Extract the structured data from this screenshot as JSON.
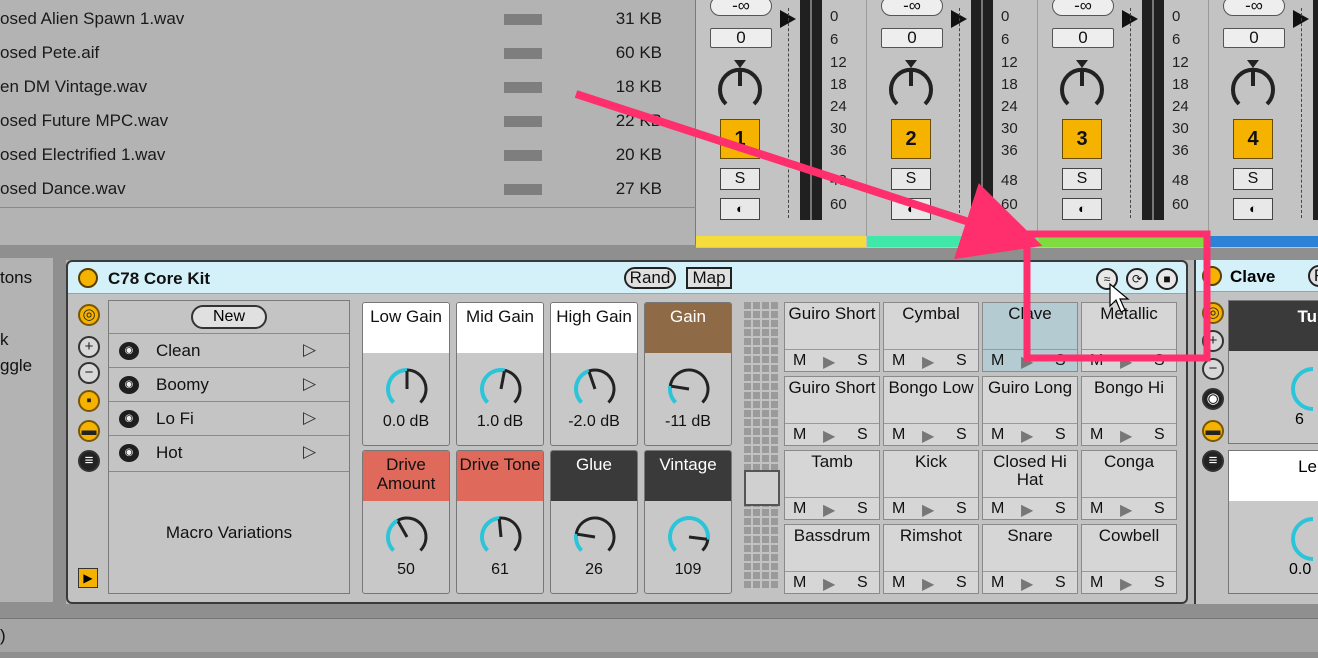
{
  "browser": {
    "files": [
      {
        "name": "osed Alien Spawn 1.wav",
        "size": "31 KB"
      },
      {
        "name": "osed Pete.aif",
        "size": "60 KB"
      },
      {
        "name": "en DM Vintage.wav",
        "size": "18 KB"
      },
      {
        "name": "osed Future MPC.wav",
        "size": "22 KB"
      },
      {
        "name": "osed Electrified 1.wav",
        "size": "20 KB"
      },
      {
        "name": "osed Dance.wav",
        "size": "27 KB"
      }
    ]
  },
  "mixer": {
    "vol_inf": "-∞",
    "vol_val": "0",
    "solo_label": "S",
    "db_scale": [
      "0",
      "6",
      "12",
      "18",
      "24",
      "30",
      "36",
      "48",
      "60"
    ],
    "tracks": [
      {
        "num": "1",
        "color": "#f3dc3c"
      },
      {
        "num": "2",
        "color": "#3fe7a8"
      },
      {
        "num": "3",
        "color": "#7fdc3f"
      },
      {
        "num": "4",
        "color": "#2b82d6"
      }
    ]
  },
  "left_panel": {
    "items": [
      "tons",
      "k",
      "ggle"
    ]
  },
  "rack": {
    "name": "C78 Core Kit",
    "rand_label": "Rand",
    "map_label": "Map",
    "new_label": "New",
    "variations": [
      "Clean",
      "Boomy",
      "Lo Fi",
      "Hot"
    ],
    "variations_label": "Macro Variations",
    "macros": [
      {
        "name": "Low Gain",
        "value": "0.0 dB",
        "color": "#ffffff",
        "text": "#111111",
        "level": 0.5
      },
      {
        "name": "Mid Gain",
        "value": "1.0 dB",
        "color": "#ffffff",
        "text": "#111111",
        "level": 0.54
      },
      {
        "name": "High Gain",
        "value": "-2.0 dB",
        "color": "#ffffff",
        "text": "#111111",
        "level": 0.43
      },
      {
        "name": "Gain",
        "value": "-11 dB",
        "color": "#8e6a46",
        "text": "#ffffff",
        "level": 0.2
      },
      {
        "name": "Drive Amount",
        "value": "50",
        "color": "#df6a5c",
        "text": "#111111",
        "level": 0.39
      },
      {
        "name": "Drive Tone",
        "value": "61",
        "color": "#df6a5c",
        "text": "#111111",
        "level": 0.48
      },
      {
        "name": "Glue",
        "value": "26",
        "color": "#3a3a3a",
        "text": "#ffffff",
        "level": 0.2
      },
      {
        "name": "Vintage",
        "value": "109",
        "color": "#3a3a3a",
        "text": "#ffffff",
        "level": 0.86
      }
    ],
    "pads": [
      {
        "name": "Guiro Short"
      },
      {
        "name": "Cymbal"
      },
      {
        "name": "Clave",
        "selected": true
      },
      {
        "name": "Metallic"
      },
      {
        "name": "Guiro Short"
      },
      {
        "name": "Bongo Low"
      },
      {
        "name": "Guiro Long"
      },
      {
        "name": "Bongo Hi"
      },
      {
        "name": "Tamb"
      },
      {
        "name": "Kick"
      },
      {
        "name": "Closed Hi Hat"
      },
      {
        "name": "Conga"
      },
      {
        "name": "Bassdrum"
      },
      {
        "name": "Rimshot"
      },
      {
        "name": "Snare"
      },
      {
        "name": "Cowbell"
      }
    ],
    "pad_mute": "M",
    "pad_solo": "S"
  },
  "clave": {
    "name": "Clave",
    "btn": "R",
    "p1_label": "Tu",
    "p1_val": "6",
    "p2_label": "Le",
    "p2_val": "0.0"
  },
  "status": {
    "text": ")"
  }
}
